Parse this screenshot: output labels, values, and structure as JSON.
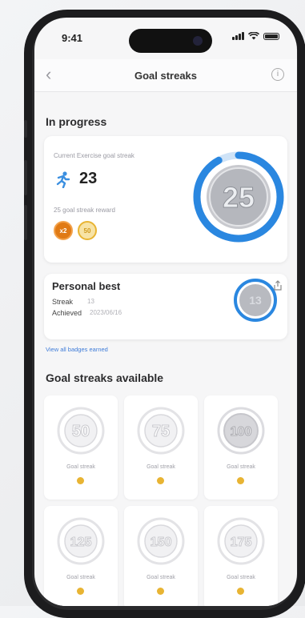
{
  "status": {
    "time": "9:41"
  },
  "nav": {
    "title": "Goal streaks",
    "back_icon": "chevron-left-icon",
    "info_icon": "info-icon"
  },
  "in_progress": {
    "title": "In progress",
    "current_label": "Current Exercise goal streak",
    "current_value": "23",
    "reward_label": "25 goal streak reward",
    "reward_coins": [
      "x2",
      "50"
    ],
    "target_badge": "25",
    "progress_fraction": 0.92
  },
  "personal_best": {
    "title": "Personal best",
    "streak_label": "Streak",
    "streak_value": "13",
    "achieved_label": "Achieved",
    "achieved_value": "2023/06/16",
    "badge_value": "13",
    "link": "View all badges earned"
  },
  "available": {
    "title": "Goal streaks available",
    "tiles": [
      {
        "number": "50",
        "label": "Goal streak"
      },
      {
        "number": "75",
        "label": "Goal streak"
      },
      {
        "number": "100",
        "label": "Goal streak"
      },
      {
        "number": "125",
        "label": "Goal streak"
      },
      {
        "number": "150",
        "label": "Goal streak"
      },
      {
        "number": "175",
        "label": "Goal streak"
      }
    ]
  },
  "colors": {
    "accent": "#2a87e0",
    "gold": "#e8b433",
    "orange": "#e07a15"
  }
}
